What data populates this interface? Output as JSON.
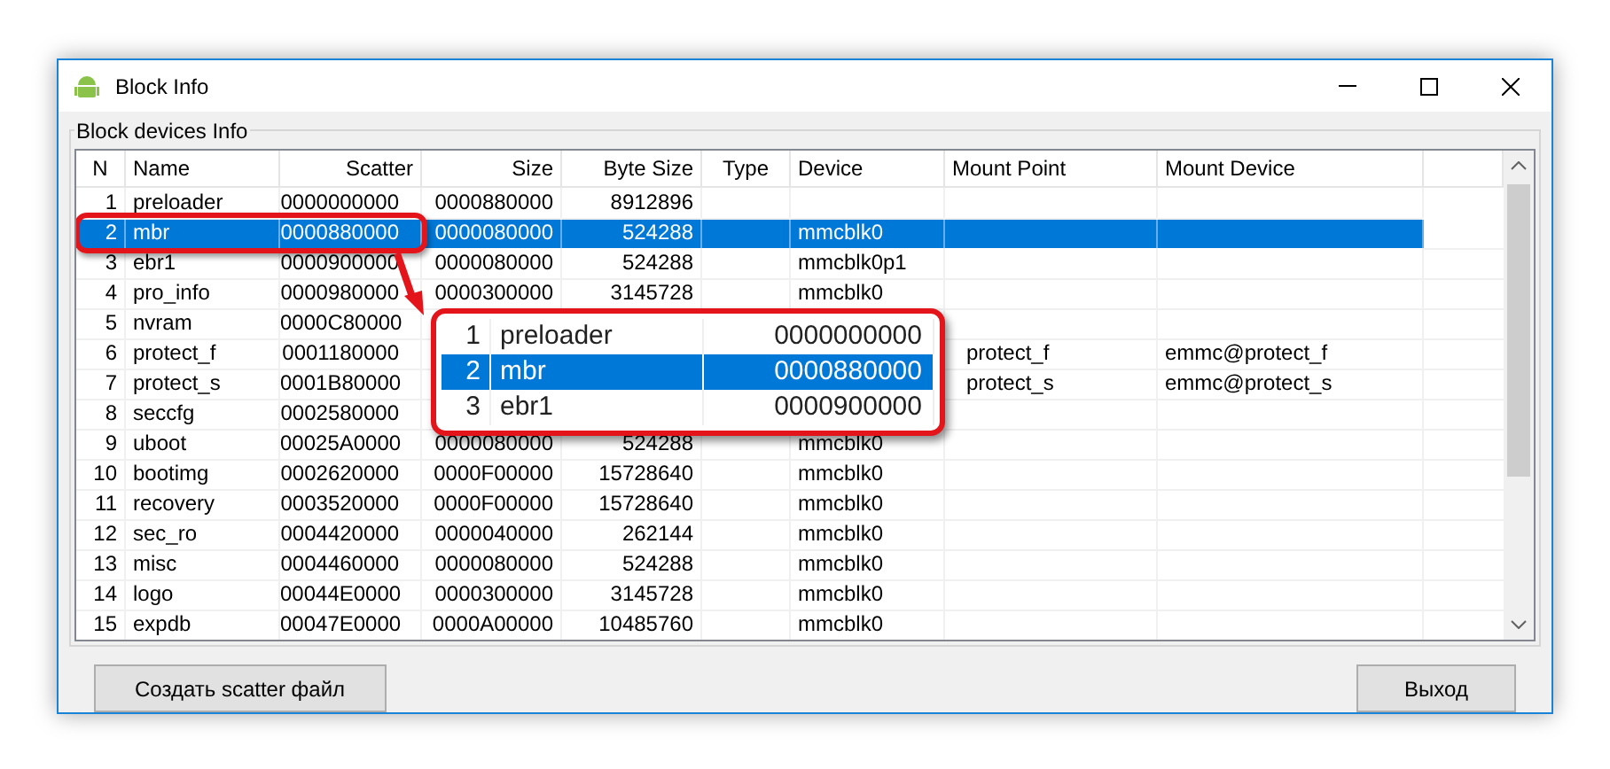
{
  "window": {
    "title": "Block Info"
  },
  "group": {
    "title": "Block devices Info"
  },
  "table": {
    "columns": [
      "N",
      "Name",
      "Scatter",
      "Size",
      "Byte Size",
      "Type",
      "Device",
      "Mount Point",
      "Mount Device"
    ],
    "rows": [
      {
        "n": "1",
        "name": "preloader",
        "scatter": "0000000000",
        "size": "0000880000",
        "byte_size": "8912896",
        "selected": false
      },
      {
        "n": "2",
        "name": "mbr",
        "scatter": "0000880000",
        "size": "0000080000",
        "byte_size": "524288",
        "device": "mmcblk0",
        "selected": true
      },
      {
        "n": "3",
        "name": "ebr1",
        "scatter": "0000900000",
        "size": "0000080000",
        "byte_size": "524288",
        "device": "mmcblk0p1",
        "selected": false
      },
      {
        "n": "4",
        "name": "pro_info",
        "scatter": "0000980000",
        "size": "0000300000",
        "byte_size": "3145728",
        "device": "mmcblk0",
        "selected": false
      },
      {
        "n": "5",
        "name": "nvram",
        "scatter": "0000C80000",
        "selected": false
      },
      {
        "n": "6",
        "name": "protect_f",
        "scatter": "0001180000",
        "mount_point": "protect_f",
        "mount_device": "emmc@protect_f",
        "selected": false
      },
      {
        "n": "7",
        "name": "protect_s",
        "scatter": "0001B80000",
        "mount_point": "protect_s",
        "mount_device": "emmc@protect_s",
        "selected": false
      },
      {
        "n": "8",
        "name": "seccfg",
        "scatter": "0002580000",
        "selected": false
      },
      {
        "n": "9",
        "name": "uboot",
        "scatter": "00025A0000",
        "size": "0000080000",
        "byte_size": "524288",
        "device": "mmcblk0",
        "selected": false
      },
      {
        "n": "10",
        "name": "bootimg",
        "scatter": "0002620000",
        "size": "0000F00000",
        "byte_size": "15728640",
        "device": "mmcblk0",
        "selected": false
      },
      {
        "n": "11",
        "name": "recovery",
        "scatter": "0003520000",
        "size": "0000F00000",
        "byte_size": "15728640",
        "device": "mmcblk0",
        "selected": false
      },
      {
        "n": "12",
        "name": "sec_ro",
        "scatter": "0004420000",
        "size": "0000040000",
        "byte_size": "262144",
        "device": "mmcblk0",
        "selected": false
      },
      {
        "n": "13",
        "name": "misc",
        "scatter": "0004460000",
        "size": "0000080000",
        "byte_size": "524288",
        "device": "mmcblk0",
        "selected": false
      },
      {
        "n": "14",
        "name": "logo",
        "scatter": "00044E0000",
        "size": "0000300000",
        "byte_size": "3145728",
        "device": "mmcblk0",
        "selected": false
      },
      {
        "n": "15",
        "name": "expdb",
        "scatter": "00047E0000",
        "size": "0000A00000",
        "byte_size": "10485760",
        "device": "mmcblk0",
        "selected": false
      }
    ]
  },
  "callout": {
    "rows": [
      {
        "n": "1",
        "name": "preloader",
        "scatter": "0000000000",
        "selected": false
      },
      {
        "n": "2",
        "name": "mbr",
        "scatter": "0000880000",
        "selected": true
      },
      {
        "n": "3",
        "name": "ebr1",
        "scatter": "0000900000",
        "selected": false
      }
    ]
  },
  "buttons": [
    "Создать scatter файл",
    "Выход"
  ]
}
